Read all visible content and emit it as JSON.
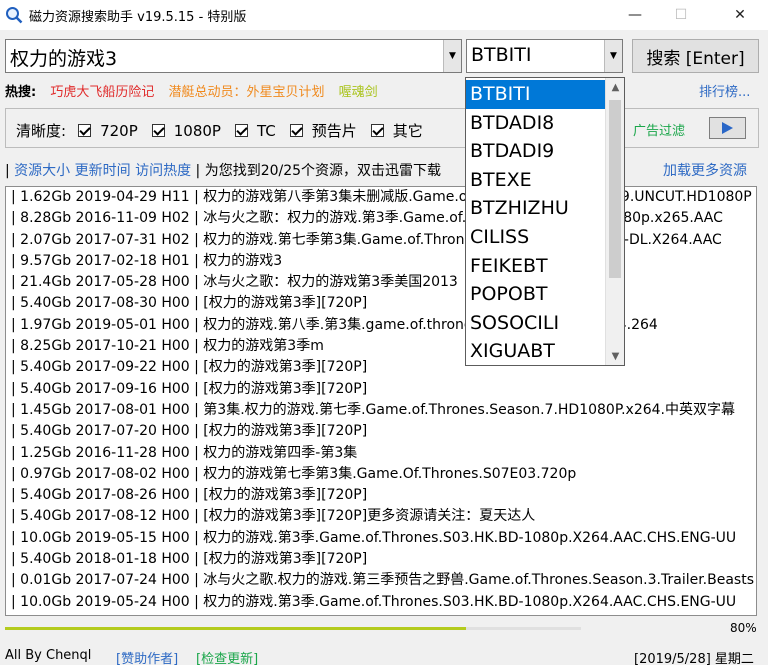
{
  "window": {
    "title": "磁力资源搜索助手 v19.5.15 - 特别版",
    "min": "—",
    "max": "☐",
    "close": "✕"
  },
  "search": {
    "query": "权力的游戏3",
    "site_selected": "BTBITI",
    "button_label": "搜索 [Enter]"
  },
  "hot": {
    "label": "热搜:",
    "items": [
      {
        "text": "巧虎大飞船历险记",
        "color": "#e02c2c"
      },
      {
        "text": "潜艇总动员：外星宝贝计划",
        "color": "#f08a1e"
      },
      {
        "text": "喔魂剑",
        "color": "#a9c31a"
      }
    ],
    "rank_label": "排行榜..."
  },
  "options": {
    "label": "清晰度:",
    "items": [
      "720P",
      "1080P",
      "TC",
      "预告片",
      "其它"
    ],
    "ad_filter_label": "广告过滤"
  },
  "sort": {
    "prefix": "|",
    "size": "资源大小",
    "time": "更新时间",
    "heat": "访问热度",
    "status": "| 为您找到20/25个资源，双击迅雷下载",
    "load_more": "加载更多资源"
  },
  "results": [
    "| 1.62Gb 2019-04-29 H11 | 权力的游戏第八季第3集未删减版.Game.of.Thrones.S08E03.2019.UNCUT.HD1080P",
    "| 8.28Gb 2016-11-09 H02 | 冰与火之歌：权力的游戏.第3季.Game.of.Thrones.S03.Bluray.1080p.x265.AAC",
    "| 2.07Gb 2017-07-31 H02 | 权力的游戏.第七季第3集.Game.of.Thrones.S07E03.1080p.WEB-DL.X264.AAC",
    "| 9.57Gb 2017-02-18 H01 | 权力的游戏3",
    "| 21.4Gb 2017-05-28 H00 | 冰与火之歌：权力的游戏第3季美国2013",
    "| 5.40Gb 2017-08-30 H00 | [权力的游戏第3季][720P]",
    "| 1.97Gb 2019-05-01 H00 | 权力的游戏.第八季.第3集.game.of.thrones.S08E03.1080p.h264.264",
    "| 8.25Gb 2017-10-21 H00 | 权力的游戏第3季m",
    "| 5.40Gb 2017-09-22 H00 | [权力的游戏第3季][720P]",
    "| 5.40Gb 2017-09-16 H00 | [权力的游戏第3季][720P]",
    "| 1.45Gb 2017-08-01 H00 | 第3集.权力的游戏.第七季.Game.of.Thrones.Season.7.HD1080P.x264.中英双字幕",
    "| 5.40Gb 2017-07-20 H00 | [权力的游戏第3季][720P]",
    "| 1.25Gb 2016-11-28 H00 | 权力的游戏第四季-第3集",
    "| 0.97Gb 2017-08-02 H00 | 权力的游戏第七季第3集.Game.Of.Thrones.S07E03.720p",
    "| 5.40Gb 2017-08-26 H00 | [权力的游戏第3季][720P]",
    "| 5.40Gb 2017-08-12 H00 | [权力的游戏第3季][720P]更多资源请关注：夏天达人",
    "| 10.0Gb 2019-05-15 H00 | 权力的游戏.第3季.Game.of.Thrones.S03.HK.BD-1080p.X264.AAC.CHS.ENG-UU",
    "| 5.40Gb 2018-01-18 H00 | [权力的游戏第3季][720P]",
    "| 0.01Gb 2017-07-24 H00 | 冰与火之歌.权力的游戏.第三季预告之野兽.Game.of.Thrones.Season.3.Trailer.Beasts",
    "| 10.0Gb 2019-05-24 H00 | 权力的游戏.第3季.Game.of.Thrones.S03.HK.BD-1080p.X264.AAC.CHS.ENG-UU"
  ],
  "progress": {
    "fraction": 0.8,
    "label": "80%"
  },
  "status": {
    "author": "All By Chenql",
    "sponsor": "[赞助作者]",
    "update": "[检查更新]",
    "date": "[2019/5/28] 星期二"
  },
  "dropdown": {
    "items": [
      "BTBITI",
      "BTDADI8",
      "BTDADI9",
      "BTEXE",
      "BTZHIZHU",
      "CILISS",
      "FEIKEBT",
      "POPOBT",
      "SOSOCILI",
      "XIGUABT"
    ],
    "selected_index": 0
  },
  "colors": {
    "link_blue": "#2e6ac4",
    "green": "#1aa64a",
    "selection": "#0078d7",
    "progress": "#b4cb1e"
  }
}
